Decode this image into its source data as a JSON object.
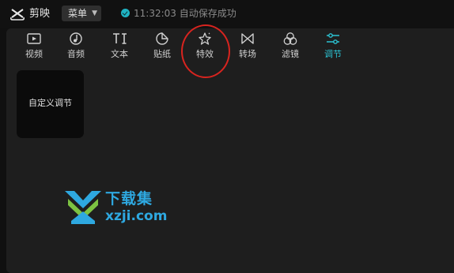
{
  "app": {
    "name": "剪映",
    "menu_label": "菜单",
    "status_time": "11:32:03",
    "status_text": "自动保存成功",
    "accent_color": "#2cc4d4"
  },
  "toolbar": {
    "tabs": [
      {
        "label": "视频",
        "icon": "video-icon",
        "active": false
      },
      {
        "label": "音频",
        "icon": "audio-icon",
        "active": false
      },
      {
        "label": "文本",
        "icon": "text-icon",
        "active": false
      },
      {
        "label": "贴纸",
        "icon": "sticker-icon",
        "active": false
      },
      {
        "label": "特效",
        "icon": "effects-star-icon",
        "active": false
      },
      {
        "label": "转场",
        "icon": "transition-icon",
        "active": false
      },
      {
        "label": "滤镜",
        "icon": "filter-icon",
        "active": false
      },
      {
        "label": "调节",
        "icon": "adjust-sliders-icon",
        "active": true
      }
    ]
  },
  "content": {
    "preset_card_label": "自定义调节"
  },
  "annotation": {
    "circle_color": "#d8241f"
  },
  "watermark": {
    "title": "下载集",
    "site": "xzji.com",
    "color": "#2ea8e0"
  }
}
